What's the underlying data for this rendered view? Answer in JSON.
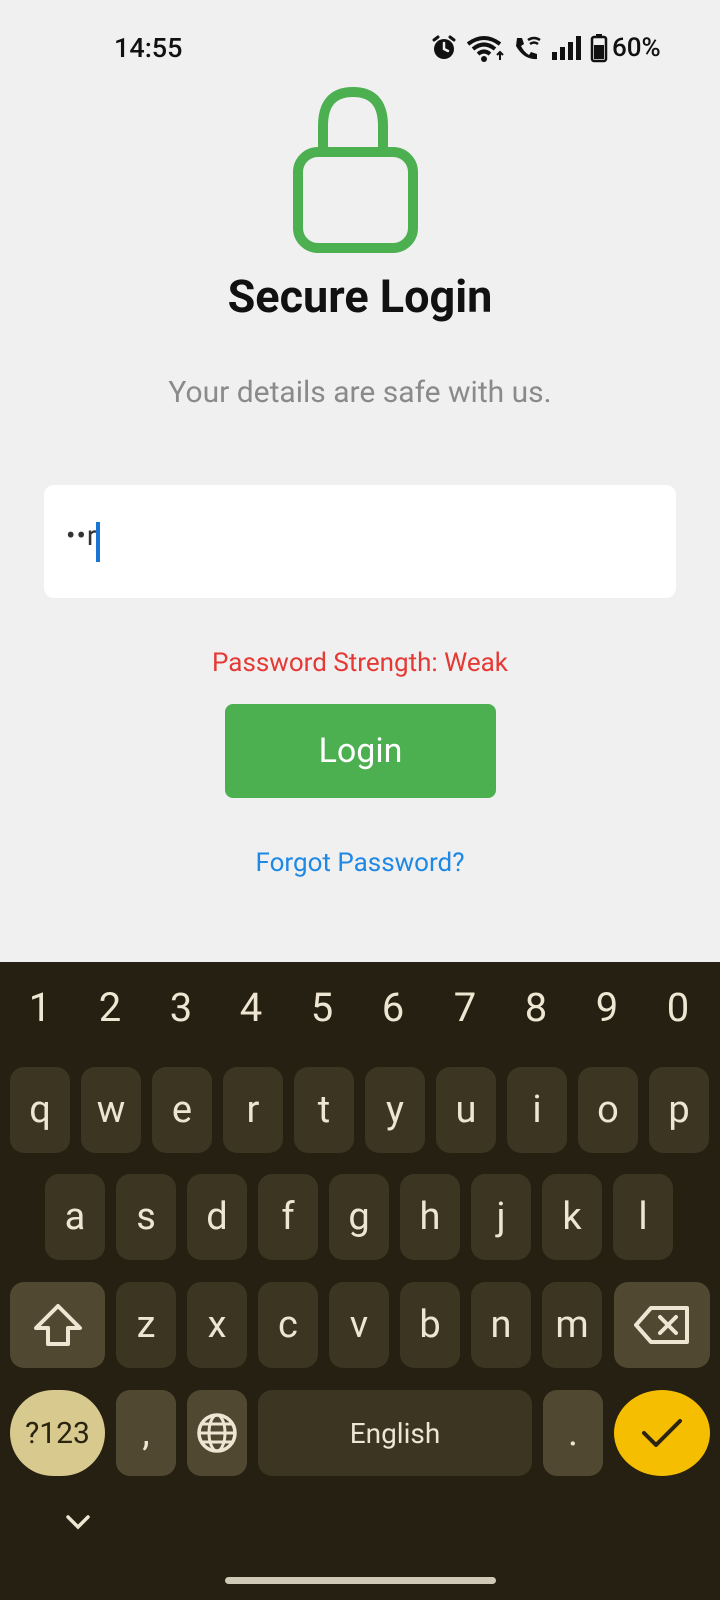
{
  "status_bar": {
    "time": "14:55",
    "battery": "60%",
    "icons": [
      "alarm-icon",
      "wifi-icon",
      "wifi-call-icon",
      "signal-icon",
      "battery-icon"
    ]
  },
  "header": {
    "title": "Secure Login",
    "subtitle": "Your details are safe with us."
  },
  "form": {
    "password_value": "••r",
    "strength_text": "Password Strength: Weak",
    "login_label": "Login",
    "forgot_label": "Forgot Password?"
  },
  "colors": {
    "accent": "#4caf50",
    "warning": "#e53935",
    "link": "#1e88e5",
    "keyboard_bg": "#252011",
    "enter_key": "#f6be00"
  },
  "keyboard": {
    "numbers": [
      "1",
      "2",
      "3",
      "4",
      "5",
      "6",
      "7",
      "8",
      "9",
      "0"
    ],
    "row1": [
      "q",
      "w",
      "e",
      "r",
      "t",
      "y",
      "u",
      "i",
      "o",
      "p"
    ],
    "row2": [
      "a",
      "s",
      "d",
      "f",
      "g",
      "h",
      "j",
      "k",
      "l"
    ],
    "row3": [
      "z",
      "x",
      "c",
      "v",
      "b",
      "n",
      "m"
    ],
    "symbols_label": "?123",
    "comma_label": ",",
    "space_label": "English",
    "period_label": "."
  }
}
